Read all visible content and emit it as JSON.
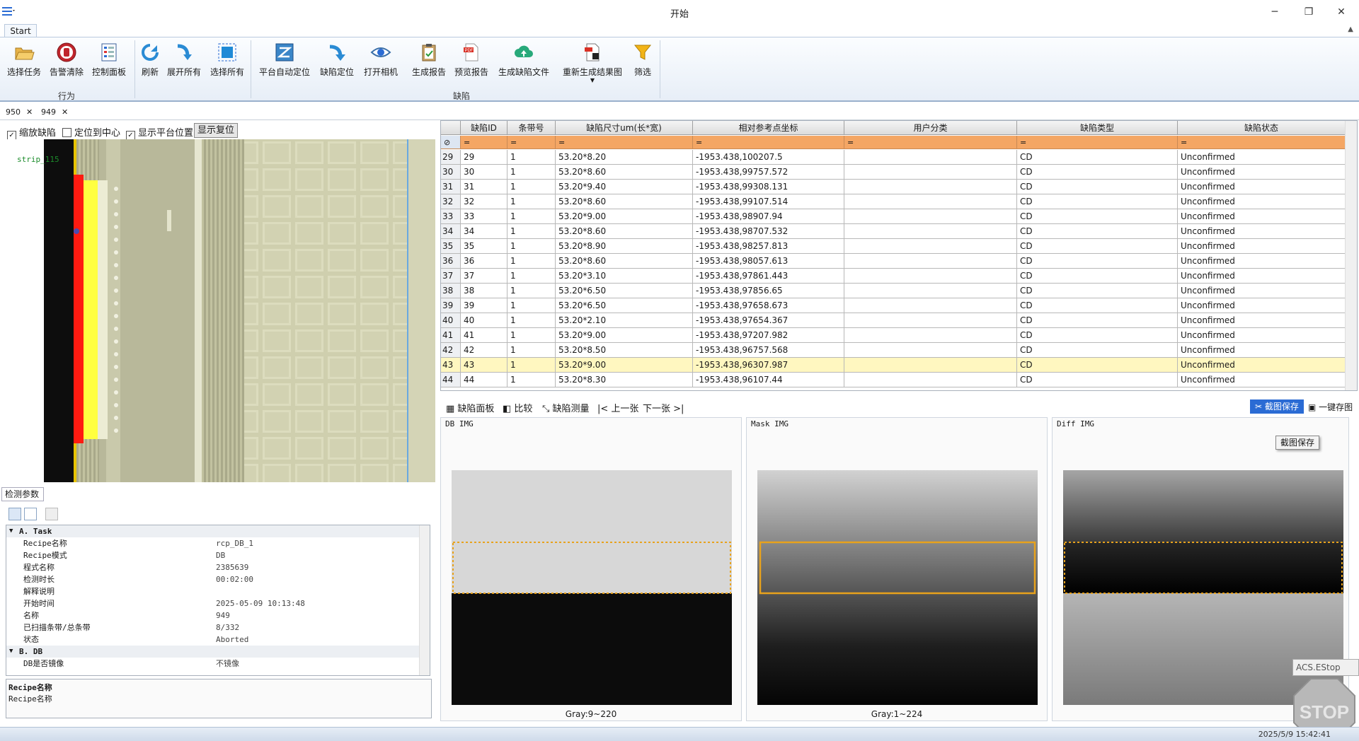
{
  "window": {
    "title": "开始",
    "minimize": "─",
    "restore": "❐",
    "close": "✕"
  },
  "ribbon": {
    "tab": "Start",
    "buttons": [
      {
        "label": "选择任务",
        "icon": "folder-open-icon"
      },
      {
        "label": "告警清除",
        "icon": "stop-hand-icon"
      },
      {
        "label": "控制面板",
        "icon": "control-panel-icon"
      },
      {
        "label": "刷新",
        "icon": "refresh-icon"
      },
      {
        "label": "展开所有",
        "icon": "expand-arrow-icon"
      },
      {
        "label": "选择所有",
        "icon": "select-all-icon"
      },
      {
        "label": "平台自动定位",
        "icon": "auto-locate-icon"
      },
      {
        "label": "缺陷定位",
        "icon": "defect-locate-icon"
      },
      {
        "label": "打开相机",
        "icon": "eye-icon"
      },
      {
        "label": "生成报告",
        "icon": "clipboard-report-icon"
      },
      {
        "label": "预览报告",
        "icon": "pdf-icon"
      },
      {
        "label": "生成缺陷文件",
        "icon": "cloud-upload-icon"
      },
      {
        "label": "重新生成结果图",
        "icon": "regen-image-icon"
      },
      {
        "label": "筛选",
        "icon": "filter-icon"
      }
    ],
    "groups": {
      "behavior": "行为",
      "defect": "缺陷"
    }
  },
  "doc_tabs": [
    {
      "label": "950"
    },
    {
      "label": "949"
    }
  ],
  "viewer": {
    "zoom_defect": "缩放缺陷",
    "center": "定位到中心",
    "show_platform": "显示平台位置",
    "reset": "显示复位",
    "strip_label": "strip_115"
  },
  "params": {
    "tab": "检测参数",
    "rows": [
      {
        "type": "cat",
        "name": "A. Task"
      },
      {
        "name": "Recipe名称",
        "value": "rcp_DB_1"
      },
      {
        "name": "Recipe模式",
        "value": "DB"
      },
      {
        "name": "程式名称",
        "value": "2385639"
      },
      {
        "name": "检测时长",
        "value": "00:02:00"
      },
      {
        "name": "解释说明",
        "value": ""
      },
      {
        "name": "开始时间",
        "value": "2025-05-09 10:13:48"
      },
      {
        "name": "名称",
        "value": "949"
      },
      {
        "name": "已扫描条带/总条带",
        "value": "8/332"
      },
      {
        "name": "状态",
        "value": "Aborted"
      },
      {
        "type": "cat",
        "name": "B. DB"
      },
      {
        "name": "DB是否镜像",
        "value": "不镜像"
      }
    ],
    "desc_title": "Recipe名称",
    "desc_text": "Recipe名称"
  },
  "table": {
    "columns": [
      "缺陷ID",
      "条带号",
      "缺陷尺寸um(长*宽)",
      "相对参考点坐标",
      "用户分类",
      "缺陷类型",
      "缺陷状态"
    ],
    "filter_symbol": "=",
    "rows": [
      [
        "29",
        "29",
        "1",
        "53.20*8.20",
        "-1953.438,100207.5",
        "",
        "CD",
        "Unconfirmed"
      ],
      [
        "30",
        "30",
        "1",
        "53.20*8.60",
        "-1953.438,99757.572",
        "",
        "CD",
        "Unconfirmed"
      ],
      [
        "31",
        "31",
        "1",
        "53.20*9.40",
        "-1953.438,99308.131",
        "",
        "CD",
        "Unconfirmed"
      ],
      [
        "32",
        "32",
        "1",
        "53.20*8.60",
        "-1953.438,99107.514",
        "",
        "CD",
        "Unconfirmed"
      ],
      [
        "33",
        "33",
        "1",
        "53.20*9.00",
        "-1953.438,98907.94",
        "",
        "CD",
        "Unconfirmed"
      ],
      [
        "34",
        "34",
        "1",
        "53.20*8.60",
        "-1953.438,98707.532",
        "",
        "CD",
        "Unconfirmed"
      ],
      [
        "35",
        "35",
        "1",
        "53.20*8.90",
        "-1953.438,98257.813",
        "",
        "CD",
        "Unconfirmed"
      ],
      [
        "36",
        "36",
        "1",
        "53.20*8.60",
        "-1953.438,98057.613",
        "",
        "CD",
        "Unconfirmed"
      ],
      [
        "37",
        "37",
        "1",
        "53.20*3.10",
        "-1953.438,97861.443",
        "",
        "CD",
        "Unconfirmed"
      ],
      [
        "38",
        "38",
        "1",
        "53.20*6.50",
        "-1953.438,97856.65",
        "",
        "CD",
        "Unconfirmed"
      ],
      [
        "39",
        "39",
        "1",
        "53.20*6.50",
        "-1953.438,97658.673",
        "",
        "CD",
        "Unconfirmed"
      ],
      [
        "40",
        "40",
        "1",
        "53.20*2.10",
        "-1953.438,97654.367",
        "",
        "CD",
        "Unconfirmed"
      ],
      [
        "41",
        "41",
        "1",
        "53.20*9.00",
        "-1953.438,97207.982",
        "",
        "CD",
        "Unconfirmed"
      ],
      [
        "42",
        "42",
        "1",
        "53.20*8.50",
        "-1953.438,96757.568",
        "",
        "CD",
        "Unconfirmed"
      ],
      [
        "43",
        "43",
        "1",
        "53.20*9.00",
        "-1953.438,96307.987",
        "",
        "CD",
        "Unconfirmed"
      ],
      [
        "44",
        "44",
        "1",
        "53.20*8.30",
        "-1953.438,96107.44",
        "",
        "CD",
        "Unconfirmed"
      ]
    ],
    "selected_index": 14
  },
  "image_toolbar": {
    "panel": "缺陷面板",
    "compare": "比较",
    "measure": "缺陷测量",
    "prev": "上一张",
    "next": "下一张",
    "capture": "截图保存",
    "onekey": "一键存图"
  },
  "panels": [
    {
      "title": "DB IMG",
      "gray": "Gray:9~220"
    },
    {
      "title": "Mask IMG",
      "gray": "Gray:1~224"
    },
    {
      "title": "Diff IMG",
      "gray": ""
    }
  ],
  "capture_popup": "截图保存",
  "acs": "ACS.EStop",
  "stop": "STOP",
  "status_time": "2025/5/9 15:42:41",
  "colors": {
    "accent": "#2a6bd4",
    "filter_row": "#f4a664",
    "selected_row": "#fff7c0"
  }
}
